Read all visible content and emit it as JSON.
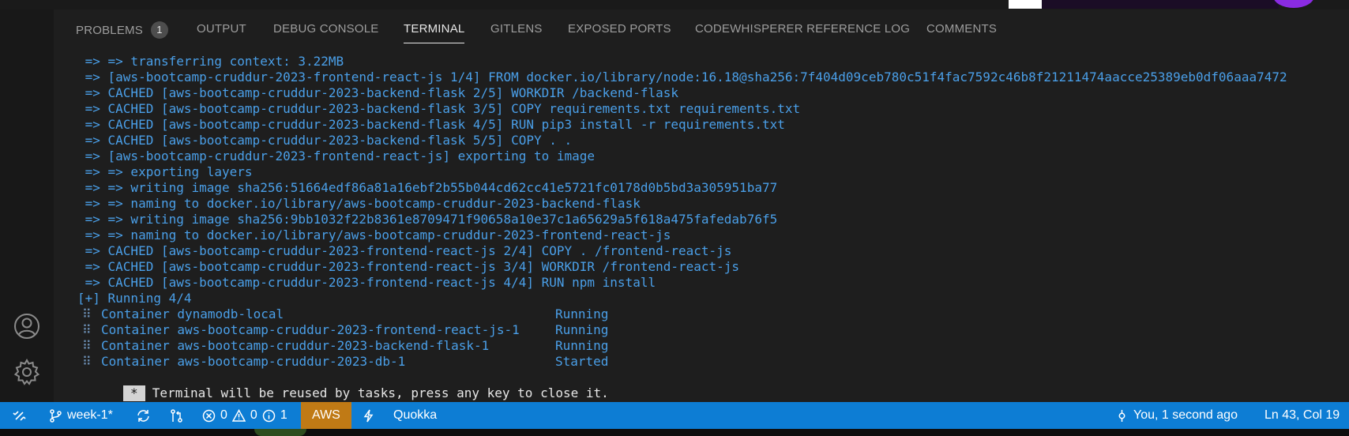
{
  "panel": {
    "tabs": [
      {
        "label": "PROBLEMS",
        "badge": "1"
      },
      {
        "label": "OUTPUT"
      },
      {
        "label": "DEBUG CONSOLE"
      },
      {
        "label": "TERMINAL"
      },
      {
        "label": "GITLENS"
      },
      {
        "label": "EXPOSED PORTS"
      },
      {
        "label": "CODEWHISPERER REFERENCE LOG"
      },
      {
        "label": "COMMENTS"
      }
    ],
    "active_tab": "TERMINAL"
  },
  "terminal": {
    "lines": [
      " => => transferring context: 3.22MB",
      " => [aws-bootcamp-cruddur-2023-frontend-react-js 1/4] FROM docker.io/library/node:16.18@sha256:7f404d09ceb780c51f4fac7592c46b8f21211474aacce25389eb0df06aaa7472",
      " => CACHED [aws-bootcamp-cruddur-2023-backend-flask 2/5] WORKDIR /backend-flask",
      " => CACHED [aws-bootcamp-cruddur-2023-backend-flask 3/5] COPY requirements.txt requirements.txt",
      " => CACHED [aws-bootcamp-cruddur-2023-backend-flask 4/5] RUN pip3 install -r requirements.txt",
      " => CACHED [aws-bootcamp-cruddur-2023-backend-flask 5/5] COPY . .",
      " => [aws-bootcamp-cruddur-2023-frontend-react-js] exporting to image",
      " => => exporting layers",
      " => => writing image sha256:51664edf86a81a16ebf2b55b044cd62cc41e5721fc0178d0b5bd3a305951ba77",
      " => => naming to docker.io/library/aws-bootcamp-cruddur-2023-backend-flask",
      " => => writing image sha256:9bb1032f22b8361e8709471f90658a10e37c1a65629a5f618a475fafedab76f5",
      " => => naming to docker.io/library/aws-bootcamp-cruddur-2023-frontend-react-js",
      " => CACHED [aws-bootcamp-cruddur-2023-frontend-react-js 2/4] COPY . /frontend-react-js",
      " => CACHED [aws-bootcamp-cruddur-2023-frontend-react-js 3/4] WORKDIR /frontend-react-js",
      " => CACHED [aws-bootcamp-cruddur-2023-frontend-react-js 4/4] RUN npm install"
    ],
    "running": "[+] Running 4/4",
    "containers": [
      {
        "name": "Container dynamodb-local",
        "status": "Running"
      },
      {
        "name": "Container aws-bootcamp-cruddur-2023-frontend-react-js-1",
        "status": "Running"
      },
      {
        "name": "Container aws-bootcamp-cruddur-2023-backend-flask-1",
        "status": "Running"
      },
      {
        "name": "Container aws-bootcamp-cruddur-2023-db-1",
        "status": "Started"
      }
    ],
    "container_prefix": "⠿",
    "notice_star": "*",
    "notice": "Terminal will be reused by tasks, press any key to close it."
  },
  "statusbar": {
    "branch": "week-1*",
    "errors": "0",
    "warnings": "0",
    "infos": "1",
    "aws": "AWS",
    "quokka": "Quokka",
    "blame": "You, 1 second ago",
    "position": "Ln 43, Col 19"
  },
  "colors": {
    "terminal_text": "#4a9fe8",
    "statusbar_bg": "#0d7dd4",
    "aws_bg": "#c07a15"
  }
}
